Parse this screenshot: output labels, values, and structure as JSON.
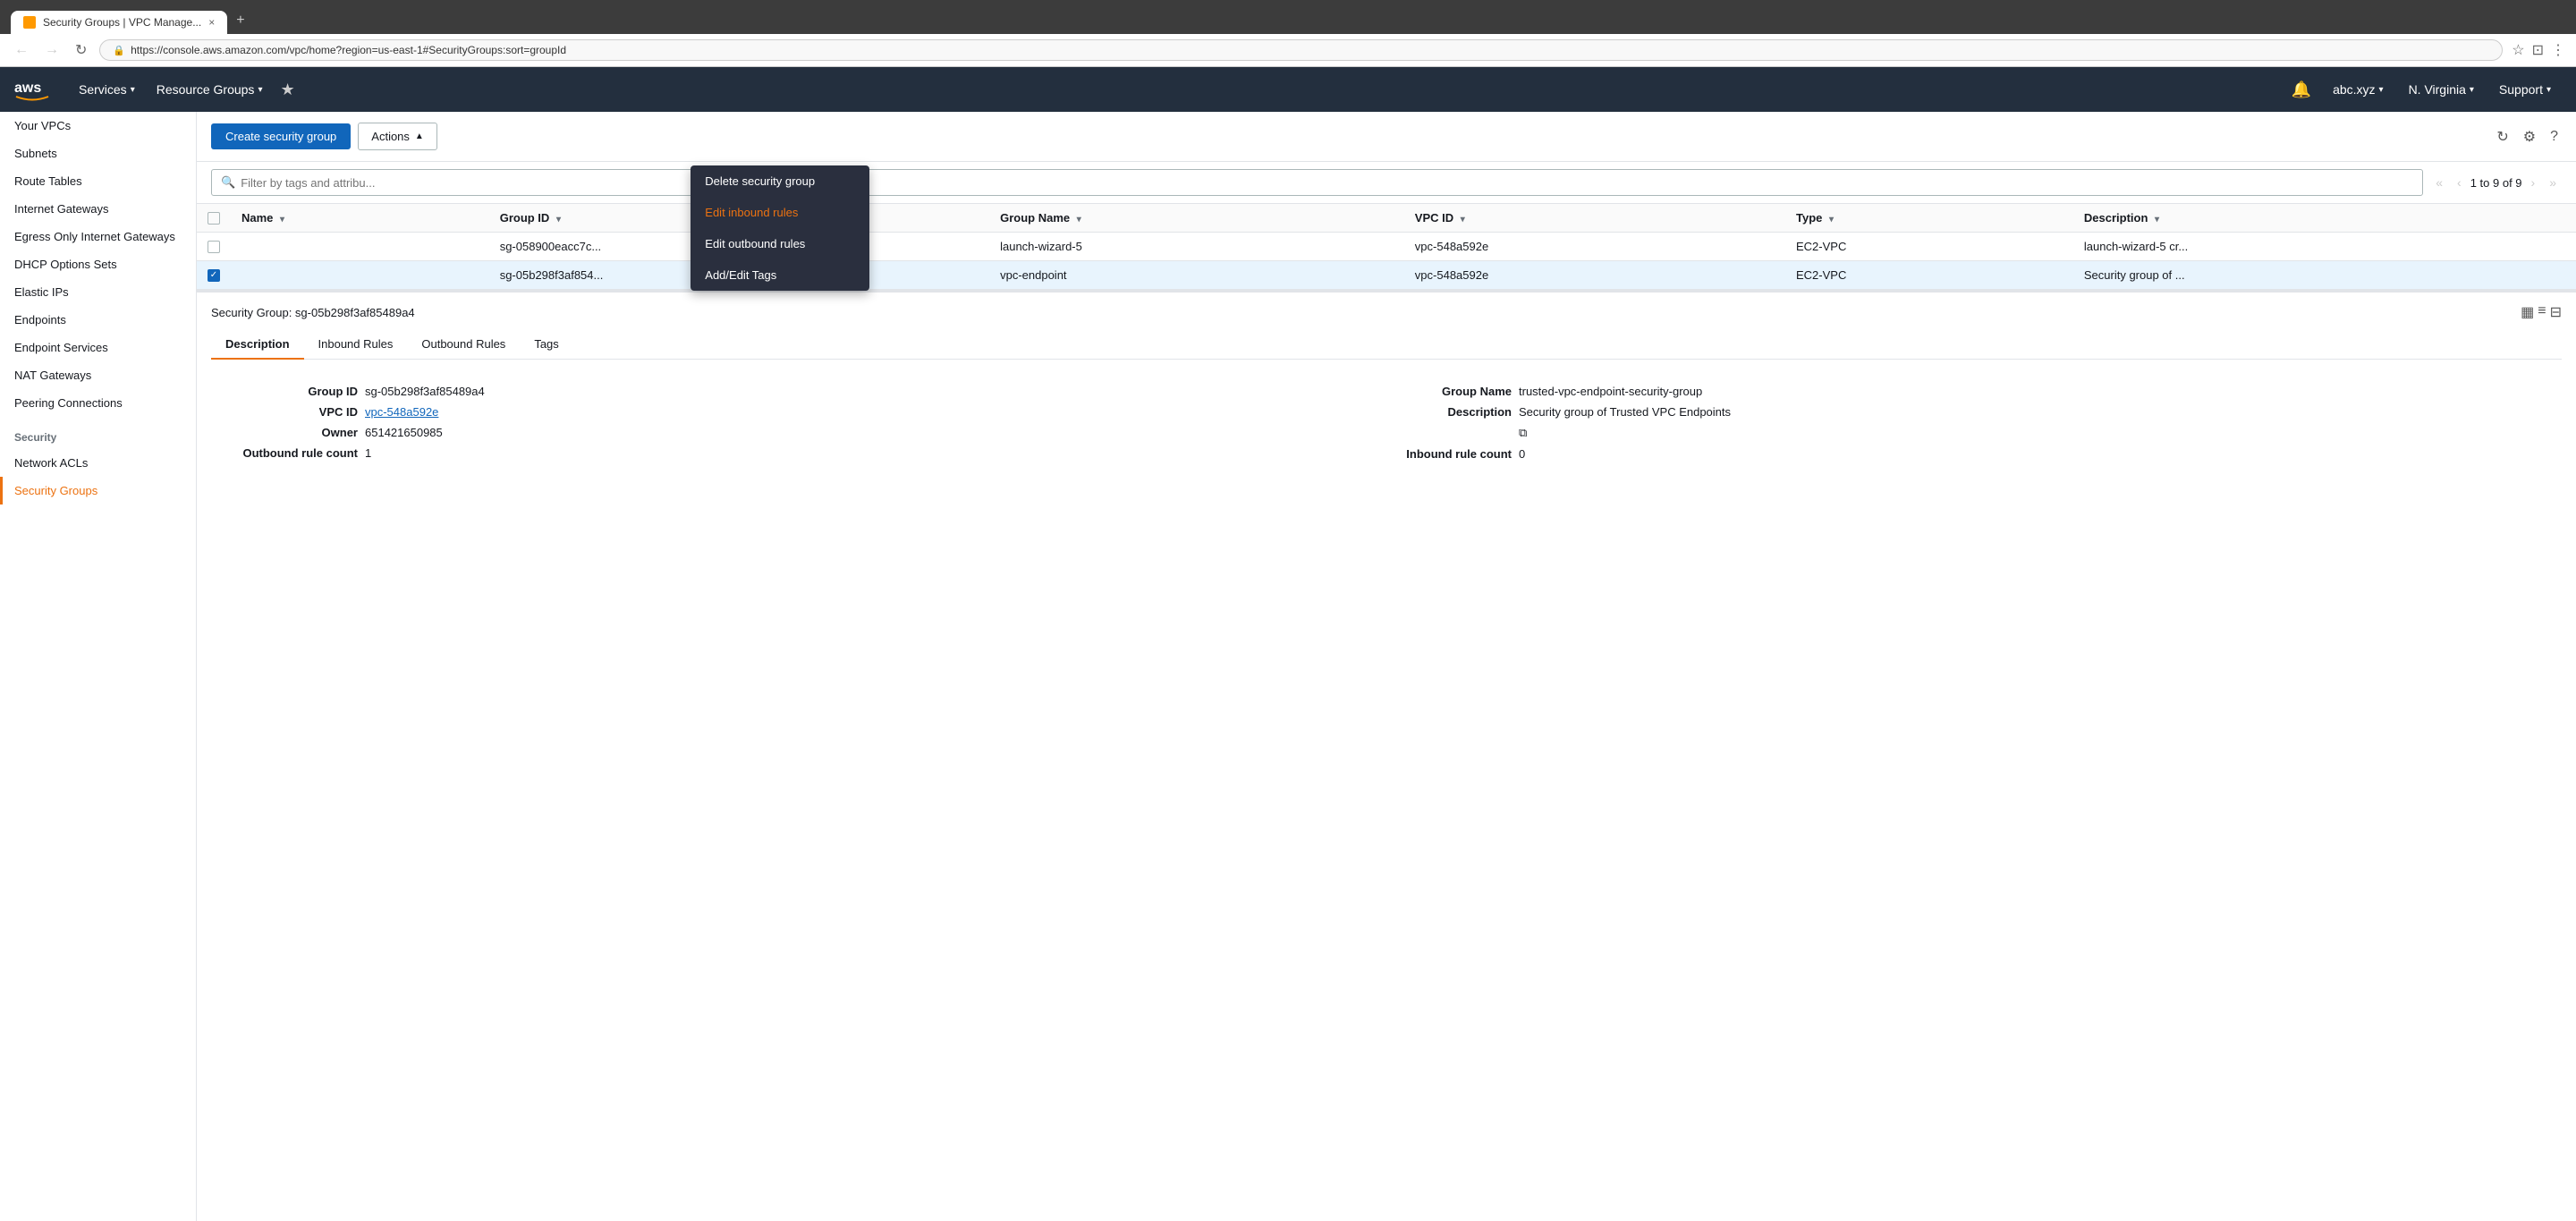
{
  "browser": {
    "tab_title": "Security Groups | VPC Manage...",
    "tab_close": "×",
    "tab_new": "+",
    "url": "https://console.aws.amazon.com/vpc/home?region=us-east-1#SecurityGroups:sort=groupId",
    "nav_back": "←",
    "nav_forward": "→",
    "nav_refresh": "↻",
    "lock_icon": "🔒"
  },
  "topnav": {
    "logo": "aws",
    "services_label": "Services",
    "resource_groups_label": "Resource Groups",
    "arrow": "▾",
    "pin_icon": "★",
    "bell_icon": "🔔",
    "account": "abc.xyz",
    "region": "N. Virginia",
    "support": "Support"
  },
  "sidebar": {
    "items": [
      {
        "label": "Your VPCs",
        "active": false
      },
      {
        "label": "Subnets",
        "active": false
      },
      {
        "label": "Route Tables",
        "active": false
      },
      {
        "label": "Internet Gateways",
        "active": false
      },
      {
        "label": "Egress Only Internet Gateways",
        "active": false
      },
      {
        "label": "DHCP Options Sets",
        "active": false
      },
      {
        "label": "Elastic IPs",
        "active": false
      },
      {
        "label": "Endpoints",
        "active": false
      },
      {
        "label": "Endpoint Services",
        "active": false
      },
      {
        "label": "NAT Gateways",
        "active": false
      },
      {
        "label": "Peering Connections",
        "active": false
      }
    ],
    "security_section_label": "Security",
    "security_items": [
      {
        "label": "Network ACLs",
        "active": false
      },
      {
        "label": "Security Groups",
        "active": true
      }
    ]
  },
  "toolbar": {
    "create_btn": "Create security group",
    "actions_btn": "Actions",
    "actions_arrow": "▲"
  },
  "dropdown": {
    "items": [
      {
        "label": "Delete security group",
        "color": "normal"
      },
      {
        "label": "Edit inbound rules",
        "color": "orange"
      },
      {
        "label": "Edit outbound rules",
        "color": "normal"
      },
      {
        "label": "Add/Edit Tags",
        "color": "normal"
      }
    ]
  },
  "filter": {
    "placeholder": "Filter by tags and attribu...",
    "search_icon": "🔍",
    "pagination_text": "1 to 9 of 9"
  },
  "table": {
    "columns": [
      {
        "label": "Name",
        "sortable": true
      },
      {
        "label": "Group ID",
        "sortable": true
      },
      {
        "label": "Group Name",
        "sortable": true
      },
      {
        "label": "VPC ID",
        "sortable": true
      },
      {
        "label": "Type",
        "sortable": true
      },
      {
        "label": "Description",
        "sortable": true
      }
    ],
    "rows": [
      {
        "selected": false,
        "name": "",
        "group_id": "sg-058900eacc7c...",
        "group_name": "launch-wizard-5",
        "vpc_id": "vpc-548a592e",
        "type": "EC2-VPC",
        "description": "launch-wizard-5 cr..."
      },
      {
        "selected": true,
        "name": "",
        "group_id": "sg-05b298f3af854...",
        "group_name": "vpc-endpoint",
        "vpc_id": "vpc-548a592e",
        "type": "EC2-VPC",
        "description": "Security group of ..."
      }
    ]
  },
  "detail": {
    "title": "Security Group: sg-05b298f3af85489a4",
    "tabs": [
      {
        "label": "Description",
        "active": true
      },
      {
        "label": "Inbound Rules",
        "active": false
      },
      {
        "label": "Outbound Rules",
        "active": false
      },
      {
        "label": "Tags",
        "active": false
      }
    ],
    "fields": {
      "group_id_label": "Group ID",
      "group_id_value": "sg-05b298f3af85489a4",
      "group_name_label": "Group Name",
      "group_name_value": "trusted-vpc-endpoint-security-group",
      "vpc_id_label": "VPC ID",
      "vpc_id_value": "vpc-548a592e",
      "description_label": "Description",
      "description_value": "Security group of Trusted VPC Endpoints",
      "owner_label": "Owner",
      "owner_value": "651421650985",
      "inbound_rule_count_label": "Inbound rule count",
      "inbound_rule_count_value": "0",
      "outbound_rule_count_label": "Outbound rule count",
      "outbound_rule_count_value": "1"
    }
  },
  "icons": {
    "refresh": "↻",
    "settings": "⚙",
    "help": "?",
    "view_grid": "▦",
    "view_list": "≡",
    "view_detail": "⊟",
    "copy": "⧉",
    "chevron_left": "‹",
    "chevron_right": "›",
    "chevron_first": "«",
    "chevron_last": "»",
    "collapse": "‹"
  },
  "colors": {
    "primary_blue": "#1166bb",
    "aws_orange": "#ec7211",
    "nav_bg": "#232f3e",
    "selected_row": "#e8f4fd",
    "dropdown_bg": "#2a2f3e"
  }
}
